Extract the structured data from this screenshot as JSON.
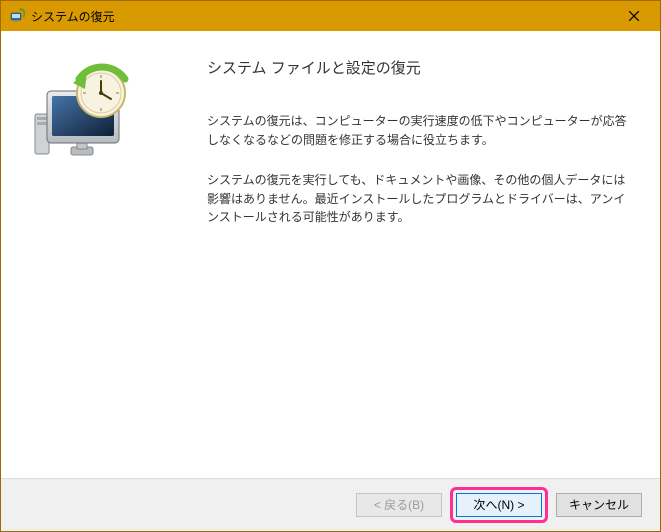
{
  "window": {
    "title": "システムの復元"
  },
  "page": {
    "heading": "システム ファイルと設定の復元",
    "paragraph1": "システムの復元は、コンピューターの実行速度の低下やコンピューターが応答しなくなるなどの問題を修正する場合に役立ちます。",
    "paragraph2": "システムの復元を実行しても、ドキュメントや画像、その他の個人データには影響はありません。最近インストールしたプログラムとドライバーは、アンインストールされる可能性があります。"
  },
  "buttons": {
    "back": "< 戻る(B)",
    "next": "次へ(N) >",
    "cancel": "キャンセル"
  }
}
